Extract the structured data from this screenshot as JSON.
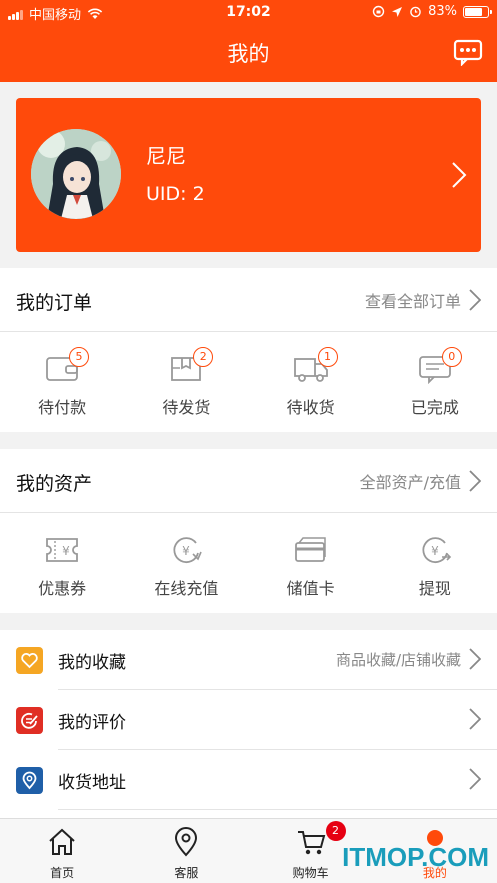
{
  "status_bar": {
    "carrier": "中国移动",
    "time": "17:02",
    "battery": "83%",
    "battery_level": 0.83
  },
  "nav": {
    "title": "我的",
    "message_icon": "chat-bubble-icon"
  },
  "profile": {
    "name": "尼尼",
    "uid": "UID: 2"
  },
  "orders": {
    "title": "我的订单",
    "link": "查看全部订单",
    "items": [
      {
        "label": "待付款",
        "badge": "5",
        "icon": "wallet-icon"
      },
      {
        "label": "待发货",
        "badge": "2",
        "icon": "package-icon"
      },
      {
        "label": "待收货",
        "badge": "1",
        "icon": "truck-icon"
      },
      {
        "label": "已完成",
        "badge": "0",
        "icon": "completed-message-icon"
      }
    ]
  },
  "assets": {
    "title": "我的资产",
    "link": "全部资产/充值",
    "items": [
      {
        "label": "优惠券",
        "icon": "coupon-icon"
      },
      {
        "label": "在线充值",
        "icon": "recharge-icon"
      },
      {
        "label": "储值卡",
        "icon": "card-icon"
      },
      {
        "label": "提现",
        "icon": "withdraw-icon"
      }
    ]
  },
  "list": [
    {
      "label": "我的收藏",
      "link": "商品收藏/店铺收藏",
      "icon": "heart-icon",
      "color": "#f5a623"
    },
    {
      "label": "我的评价",
      "link": "",
      "icon": "review-icon",
      "color": "#e02e24"
    },
    {
      "label": "收货地址",
      "link": "",
      "icon": "location-icon",
      "color": "#1f5fa8"
    }
  ],
  "tabbar": {
    "items": [
      {
        "label": "首页",
        "icon": "home-icon"
      },
      {
        "label": "客服",
        "icon": "pin-icon"
      },
      {
        "label": "购物车",
        "icon": "cart-icon",
        "badge": "2"
      },
      {
        "label": "我的",
        "icon": "me-icon"
      }
    ]
  },
  "watermark": "ITMOP.COM",
  "colors": {
    "primary": "#ff4a0b",
    "watermark": "#1a9dbb"
  }
}
